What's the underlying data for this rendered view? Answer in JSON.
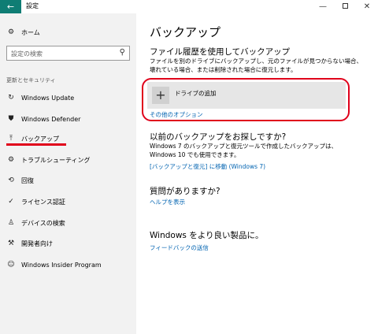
{
  "window": {
    "title": "設定",
    "back_glyph": "←",
    "min_glyph": "—",
    "close_glyph": "✕"
  },
  "sidebar": {
    "home_label": "ホーム",
    "search_placeholder": "設定の検索",
    "section_title": "更新とセキュリティ",
    "items": [
      {
        "label": "Windows Update",
        "icon": "sync-icon",
        "glyph": "↻"
      },
      {
        "label": "Windows Defender",
        "icon": "shield-icon",
        "glyph": "⛊"
      },
      {
        "label": "バックアップ",
        "icon": "backup-icon",
        "glyph": "⤒",
        "active": true
      },
      {
        "label": "トラブルシューティング",
        "icon": "wrench-icon",
        "glyph": "🔧"
      },
      {
        "label": "回復",
        "icon": "recovery-icon",
        "glyph": "⟲"
      },
      {
        "label": "ライセンス認証",
        "icon": "check-circle-icon",
        "glyph": "✓"
      },
      {
        "label": "デバイスの検索",
        "icon": "person-location-icon",
        "glyph": "♙"
      },
      {
        "label": "開発者向け",
        "icon": "developer-icon",
        "glyph": "⚒"
      },
      {
        "label": "Windows Insider Program",
        "icon": "insider-icon",
        "glyph": "☺"
      }
    ],
    "accent_color": "#e0001b"
  },
  "main": {
    "page_title": "バックアップ",
    "file_history": {
      "heading": "ファイル履歴を使用してバックアップ",
      "description": "ファイルを別のドライブにバックアップし、元のファイルが見つからない場合、壊れている場合、または削除された場合に復元します。",
      "add_drive_label": "ドライブの追加",
      "more_options_link": "その他のオプション"
    },
    "older_backup": {
      "heading": "以前のバックアップをお探しですか?",
      "description": "Windows 7 のバックアップと復元ツールで作成したバックアップは、Windows 10 でも使用できます。",
      "link": "[バックアップと復元] に移動 (Windows 7)"
    },
    "question": {
      "heading": "質問がありますか?",
      "link": "ヘルプを表示"
    },
    "improve": {
      "heading": "Windows をより良い製品に。",
      "link": "フィードバックの送信"
    },
    "link_color": "#0063b1"
  }
}
